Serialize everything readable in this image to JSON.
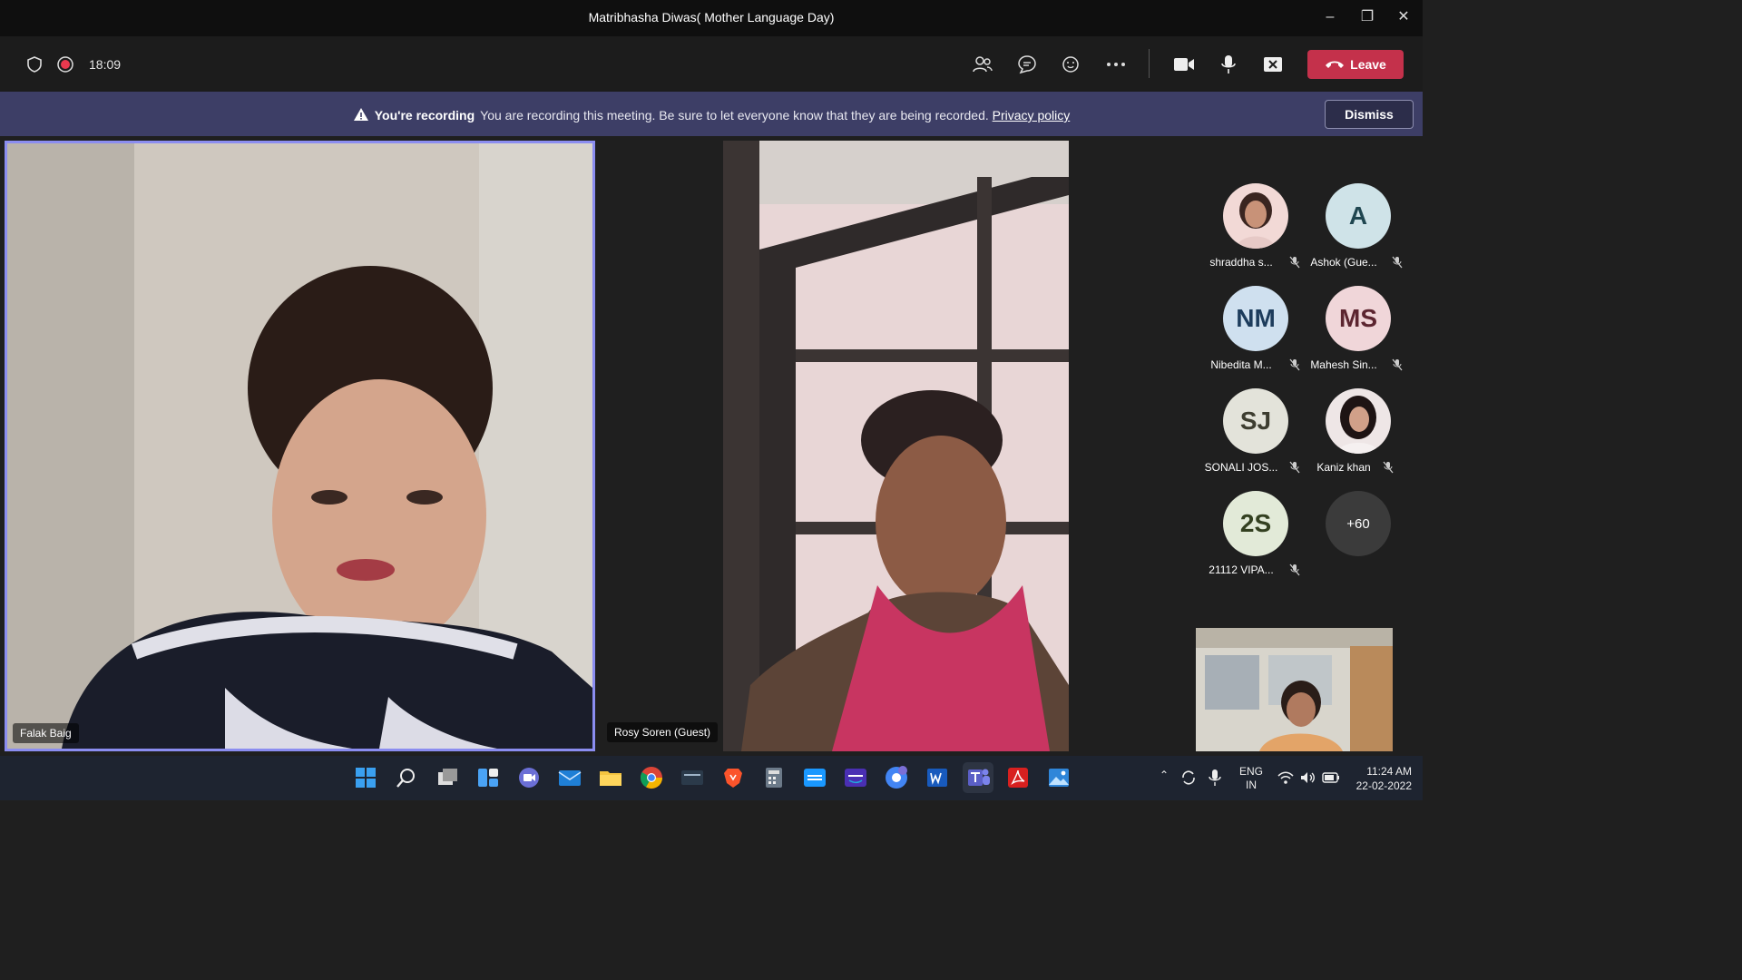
{
  "window": {
    "title": "Matribhasha Diwas( Mother Language Day)"
  },
  "toolbar": {
    "timer": "18:09",
    "leave_label": "Leave"
  },
  "banner": {
    "heading": "You're recording",
    "message": "You are recording this meeting. Be sure to let everyone know that they are being recorded.",
    "link": "Privacy policy",
    "dismiss_label": "Dismiss"
  },
  "tiles": {
    "main_speaker": "Falak Baig",
    "second_speaker": "Rosy Soren (Guest)"
  },
  "participants": [
    {
      "name": "shraddha s...",
      "initials": "",
      "color": "#f2d9d6"
    },
    {
      "name": "Ashok (Gue...",
      "initials": "A",
      "color": "#cfe3e8"
    },
    {
      "name": "Nibedita M...",
      "initials": "NM",
      "color": "#cfe0ef"
    },
    {
      "name": "Mahesh Sin...",
      "initials": "MS",
      "color": "#f0d6d9"
    },
    {
      "name": "SONALI JOS...",
      "initials": "SJ",
      "color": "#e3e3da"
    },
    {
      "name": "Kaniz khan",
      "initials": "",
      "color": "#eee6e6"
    },
    {
      "name": "21112 VIPA...",
      "initials": "2S",
      "color": "#e2ead8"
    }
  ],
  "more_count": "+60",
  "taskbar": {
    "lang_line1": "ENG",
    "lang_line2": "IN",
    "time": "11:24 AM",
    "date": "22-02-2022"
  },
  "icons": [
    "shield-icon",
    "record-icon",
    "people-icon",
    "chat-icon",
    "reactions-icon",
    "more-icon",
    "camera-icon",
    "mic-icon",
    "share-icon",
    "phone-icon",
    "warning-icon"
  ]
}
